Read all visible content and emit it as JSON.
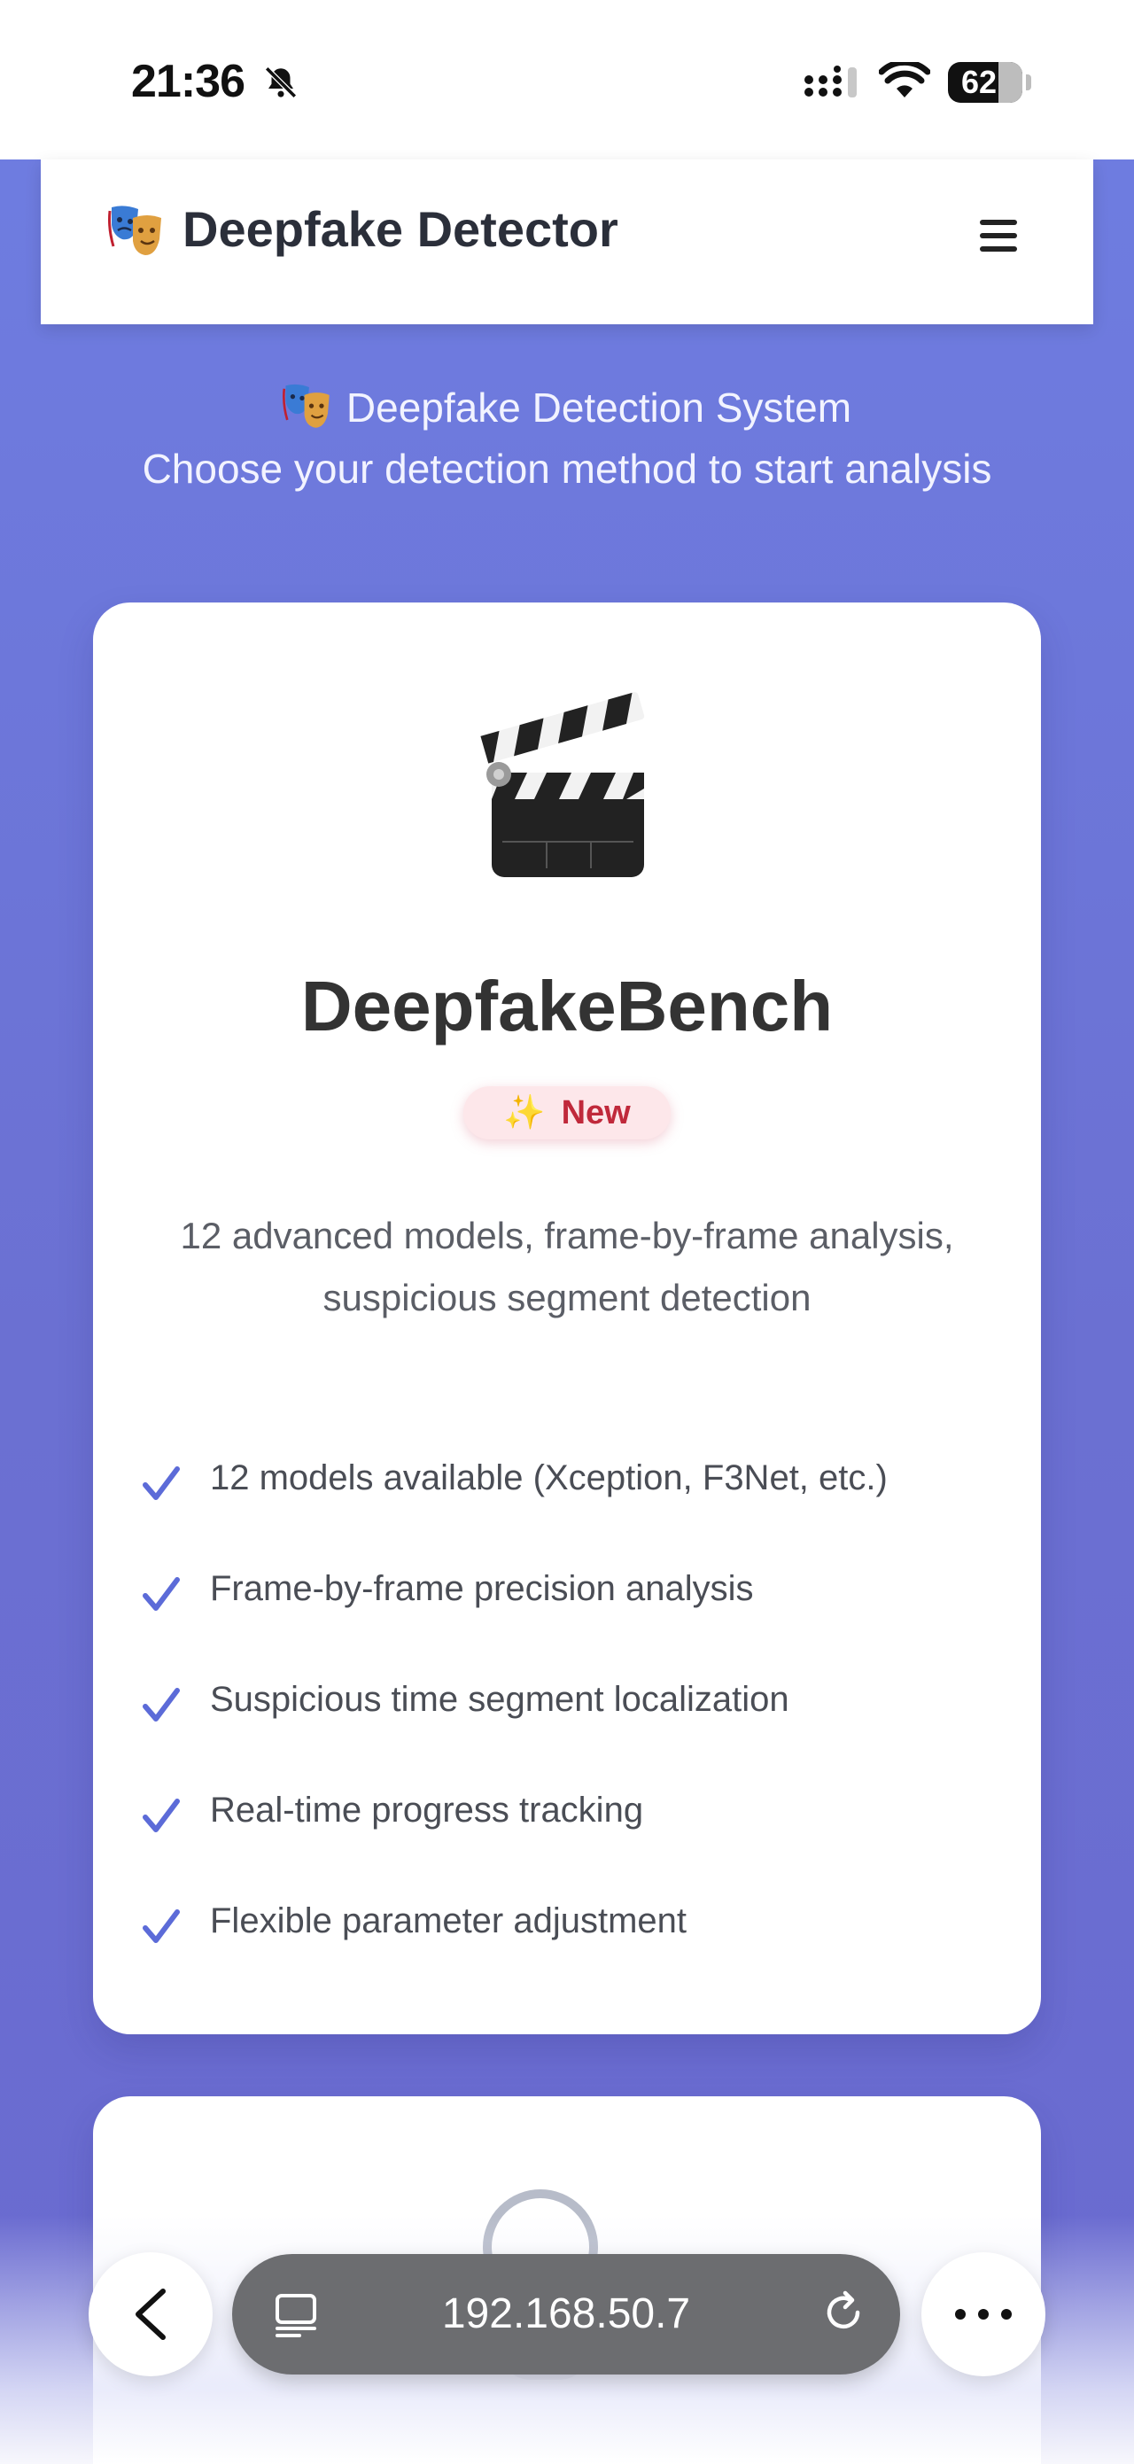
{
  "status_bar": {
    "time": "21:36",
    "battery": "62"
  },
  "navbar": {
    "brand_icon": "theater-masks-icon",
    "brand_title": "Deepfake Detector",
    "menu_icon": "hamburger-menu-icon"
  },
  "hero": {
    "icon": "theater-masks-icon",
    "title": "Deepfake Detection System",
    "subtitle": "Choose your detection method to start analysis"
  },
  "cards": [
    {
      "icon": "clapper-board-icon",
      "title": "DeepfakeBench",
      "badge": "New",
      "description": "12 advanced models, frame-by-frame analysis, suspicious segment detection",
      "features": [
        "12 models available (Xception, F3Net, etc.)",
        "Frame-by-frame precision analysis",
        "Suspicious time segment localization",
        "Real-time progress tracking",
        "Flexible parameter adjustment"
      ]
    }
  ],
  "browser": {
    "url": "192.168.50.7"
  },
  "colors": {
    "background": "#6c76d6",
    "accent": "#5c6bd8",
    "badge_bg": "#fde7ea",
    "badge_text": "#c0293b"
  }
}
